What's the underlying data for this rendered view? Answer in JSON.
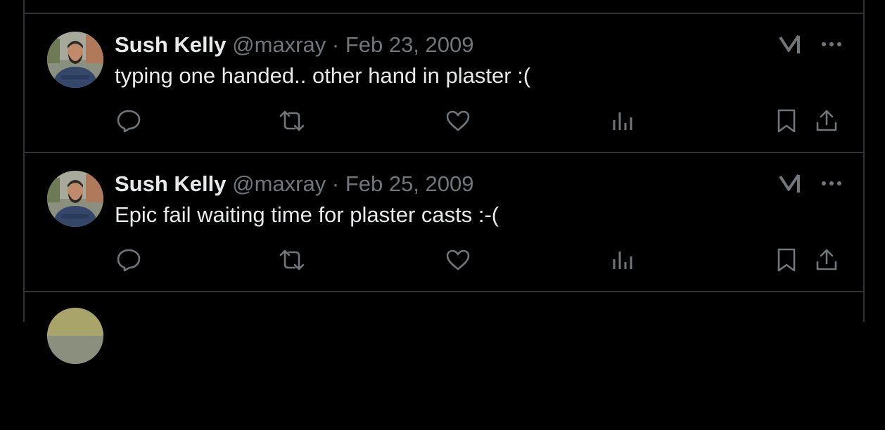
{
  "tweets": [
    {
      "name": "Sush Kelly",
      "handle": "@maxray",
      "separator": "·",
      "date": "Feb 23, 2009",
      "text": "typing one handed.. other hand in plaster :("
    },
    {
      "name": "Sush Kelly",
      "handle": "@maxray",
      "separator": "·",
      "date": "Feb 25, 2009",
      "text": "Epic fail waiting time for plaster casts :-("
    }
  ],
  "icons": {
    "grok": "grok-icon",
    "more": "more-options-icon",
    "reply": "reply-icon",
    "retweet": "retweet-icon",
    "like": "like-icon",
    "views": "views-icon",
    "bookmark": "bookmark-icon",
    "share": "share-icon"
  },
  "colors": {
    "background": "#000000",
    "border": "#2f3336",
    "primary_text": "#e7e9ea",
    "secondary_text": "#71767b"
  }
}
